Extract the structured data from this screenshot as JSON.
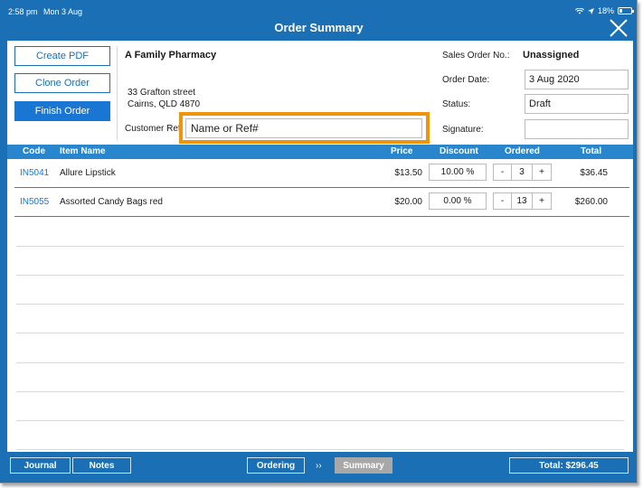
{
  "statusbar": {
    "time": "2:58 pm",
    "date": "Mon 3 Aug",
    "battery": "18%"
  },
  "header": {
    "title": "Order Summary"
  },
  "actions": {
    "create_pdf": "Create PDF",
    "clone_order": "Clone Order",
    "finish_order": "Finish Order"
  },
  "customer": {
    "name": "A Family Pharmacy",
    "address_line1": "33 Grafton street",
    "address_line2": "Cairns, QLD 4870",
    "ref_label": "Customer Ref",
    "ref_placeholder": "Name or Ref#"
  },
  "order": {
    "sales_order_label": "Sales Order No.:",
    "sales_order_value": "Unassigned",
    "date_label": "Order Date:",
    "date_value": "3 Aug 2020",
    "status_label": "Status:",
    "status_value": "Draft",
    "signature_label": "Signature:"
  },
  "table": {
    "headers": {
      "code": "Code",
      "item_name": "Item Name",
      "price": "Price",
      "discount": "Discount",
      "ordered": "Ordered",
      "total": "Total"
    },
    "rows": [
      {
        "code": "IN5041",
        "name": "Allure Lipstick",
        "price": "$13.50",
        "discount": "10.00 %",
        "qty": "3",
        "total": "$36.45"
      },
      {
        "code": "IN5055",
        "name": "Assorted Candy Bags red",
        "price": "$20.00",
        "discount": "0.00 %",
        "qty": "13",
        "total": "$260.00"
      }
    ],
    "minus": "-",
    "plus": "+"
  },
  "footer": {
    "journal": "Journal",
    "notes": "Notes",
    "ordering": "Ordering",
    "chevrons": "››",
    "summary": "Summary",
    "total": "Total: $296.45"
  },
  "colors": {
    "brand_blue": "#1b6fb5",
    "highlight_orange": "#f0950a",
    "link_blue": "#1976d2"
  }
}
